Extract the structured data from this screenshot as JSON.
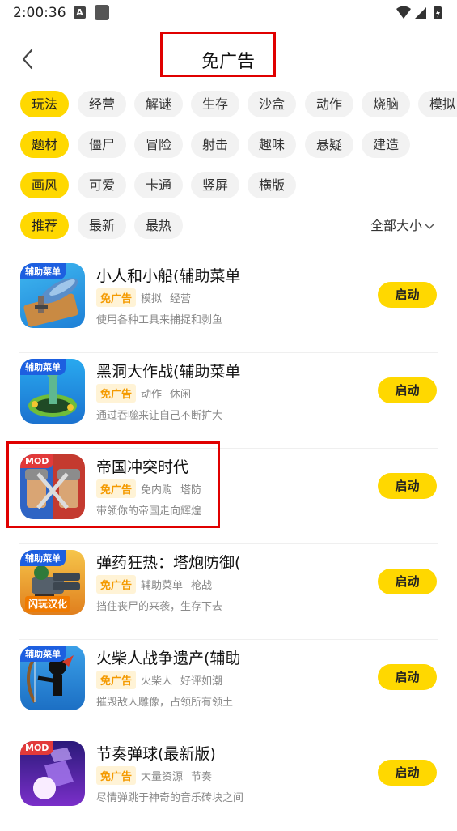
{
  "status": {
    "time": "2:00:36",
    "notif_icon_letter": "A"
  },
  "header": {
    "title": "免广告"
  },
  "filters": {
    "play": {
      "category": "玩法",
      "options": [
        "经营",
        "解谜",
        "生存",
        "沙盒",
        "动作",
        "烧脑",
        "模拟"
      ]
    },
    "theme": {
      "category": "题材",
      "options": [
        "僵尸",
        "冒险",
        "射击",
        "趣味",
        "悬疑",
        "建造"
      ]
    },
    "style": {
      "category": "画风",
      "options": [
        "可爱",
        "卡通",
        "竖屏",
        "横版"
      ]
    },
    "sort": {
      "options": [
        "推荐",
        "最新",
        "最热"
      ],
      "size": "全部大小"
    }
  },
  "apps": [
    {
      "name": "小人和小船(辅助菜单",
      "badge": "辅助菜单",
      "badge_color": "#1d5fe0",
      "tags": [
        "免广告",
        "模拟",
        "经营"
      ],
      "desc": "使用各种工具来捕捉和剥鱼",
      "button": "启动",
      "icon": "fish-boat-icon"
    },
    {
      "name": "黑洞大作战(辅助菜单",
      "badge": "辅助菜单",
      "badge_color": "#1d5fe0",
      "tags": [
        "免广告",
        "动作",
        "休闲"
      ],
      "desc": "通过吞噬来让自己不断扩大",
      "button": "启动",
      "icon": "black-hole-icon"
    },
    {
      "name": "帝国冲突时代",
      "badge": "MOD",
      "badge_color": "#e23a3a",
      "tags": [
        "免广告",
        "免内购",
        "塔防"
      ],
      "desc": "带领你的帝国走向辉煌",
      "button": "启动",
      "icon": "empire-knights-icon"
    },
    {
      "name": "弹药狂热：塔炮防御(",
      "badge": "辅助菜单",
      "badge_color": "#1d5fe0",
      "bottom_badge": "闪玩汉化",
      "tags": [
        "免广告",
        "辅助菜单",
        "枪战"
      ],
      "desc": "挡住丧尸的来袭，生存下去",
      "button": "启动",
      "icon": "gatling-turret-icon"
    },
    {
      "name": "火柴人战争遗产(辅助",
      "badge": "辅助菜单",
      "badge_color": "#1d5fe0",
      "tags": [
        "免广告",
        "火柴人",
        "好评如潮"
      ],
      "desc": "摧毁敌人雕像，占领所有领土",
      "button": "启动",
      "icon": "stickman-archer-icon"
    },
    {
      "name": "节奏弹球(最新版)",
      "badge": "MOD",
      "badge_color": "#e23a3a",
      "tags": [
        "免广告",
        "大量资源",
        "节奏"
      ],
      "desc": "尽情弹跳于神奇的音乐砖块之间",
      "button": "启动",
      "icon": "rhythm-ball-icon"
    }
  ]
}
